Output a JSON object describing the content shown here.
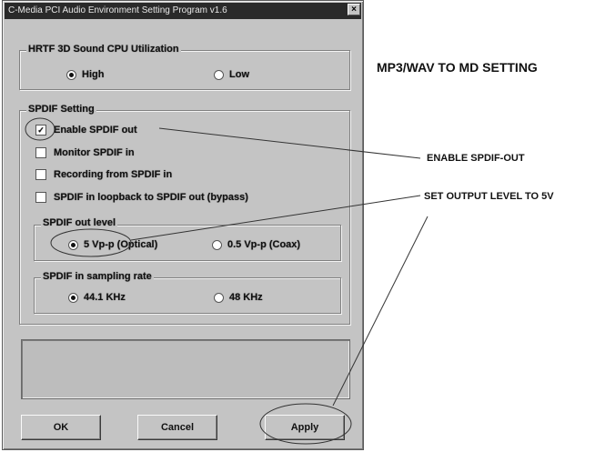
{
  "window": {
    "title": "C-Media PCI Audio Environment Setting Program v1.6",
    "close_glyph": "×"
  },
  "hrtf": {
    "label": "HRTF 3D Sound CPU Utilization",
    "options": [
      {
        "label": "High",
        "selected": true
      },
      {
        "label": "Low",
        "selected": false
      }
    ]
  },
  "spdif": {
    "label": "SPDIF Setting",
    "checkboxes": [
      {
        "label": "Enable SPDIF out",
        "checked": true
      },
      {
        "label": "Monitor SPDIF in",
        "checked": false
      },
      {
        "label": "Recording from SPDIF in",
        "checked": false
      },
      {
        "label": "SPDIF in loopback to SPDIF out (bypass)",
        "checked": false
      }
    ],
    "check_glyph": "✓",
    "out_level": {
      "label": "SPDIF out level",
      "options": [
        {
          "label": "5 Vp-p (Optical)",
          "selected": true
        },
        {
          "label": "0.5 Vp-p (Coax)",
          "selected": false
        }
      ]
    },
    "sampling": {
      "label": "SPDIF in sampling rate",
      "options": [
        {
          "label": "44.1 KHz",
          "selected": true
        },
        {
          "label": "48 KHz",
          "selected": false
        }
      ]
    }
  },
  "buttons": {
    "ok": "OK",
    "cancel": "Cancel",
    "apply": "Apply"
  },
  "annotations": {
    "title": "MP3/WAV TO MD SETTING",
    "enable": "ENABLE SPDIF-OUT",
    "level": "SET OUTPUT LEVEL TO 5V"
  }
}
